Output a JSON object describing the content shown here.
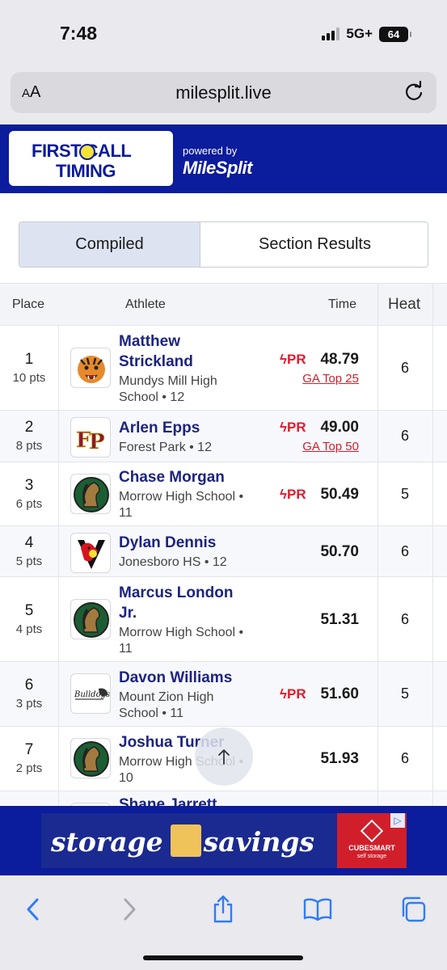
{
  "status_bar": {
    "time": "7:48",
    "network": "5G+",
    "battery": "64"
  },
  "browser": {
    "aa_label": "AA",
    "url": "milesplit.live"
  },
  "header": {
    "logo_line1": "FIRST CALL",
    "logo_line2": "TIMING",
    "powered_by": "powered by",
    "milesplit": "MileSplit"
  },
  "tabs": [
    {
      "label": "Compiled",
      "selected": true
    },
    {
      "label": "Section Results",
      "selected": false
    }
  ],
  "table": {
    "columns": {
      "place": "Place",
      "athlete": "Athlete",
      "time": "Time",
      "heat": "Heat"
    },
    "rows": [
      {
        "place": "1",
        "pts": "10 pts",
        "name": "Matthew Strickland",
        "school": "Mundys Mill High School • 12",
        "pr": "PR",
        "time": "48.79",
        "top": "GA Top 25",
        "heat": "6",
        "logo": "tiger"
      },
      {
        "place": "2",
        "pts": "8 pts",
        "name": "Arlen Epps",
        "school": "Forest Park • 12",
        "pr": "PR",
        "time": "49.00",
        "top": "GA Top 50",
        "heat": "6",
        "logo": "fp"
      },
      {
        "place": "3",
        "pts": "6 pts",
        "name": "Chase Morgan",
        "school": "Morrow High School • 11",
        "pr": "PR",
        "time": "50.49",
        "top": "",
        "heat": "5",
        "logo": "mustang"
      },
      {
        "place": "4",
        "pts": "5 pts",
        "name": "Dylan Dennis",
        "school": "Jonesboro HS • 12",
        "pr": "",
        "time": "50.70",
        "top": "",
        "heat": "6",
        "logo": "cardinal"
      },
      {
        "place": "5",
        "pts": "4 pts",
        "name": "Marcus London Jr.",
        "school": "Morrow High School • 11",
        "pr": "",
        "time": "51.31",
        "top": "",
        "heat": "6",
        "logo": "mustang"
      },
      {
        "place": "6",
        "pts": "3 pts",
        "name": "Davon Williams",
        "school": "Mount Zion High School • 11",
        "pr": "PR",
        "time": "51.60",
        "top": "",
        "heat": "5",
        "logo": "bulldogs"
      },
      {
        "place": "7",
        "pts": "2 pts",
        "name": "Joshua Turner",
        "school": "Morrow High School • 10",
        "pr": "",
        "time": "51.93",
        "top": "",
        "heat": "6",
        "logo": "mustang"
      },
      {
        "place": "",
        "pts": "",
        "name": "Shane Jarrett",
        "school": "",
        "pr": "",
        "time": "",
        "top": "",
        "heat": "",
        "logo": "tiger"
      }
    ]
  },
  "ad": {
    "word1": "storage",
    "word2": "savings",
    "brand": "CUBESMART",
    "brand_sub": "self storage",
    "logo_text": "Bulldogs"
  },
  "colors": {
    "brand_blue": "#0b1c9c",
    "name_blue": "#1c2480",
    "pr_red": "#e21b2c"
  }
}
